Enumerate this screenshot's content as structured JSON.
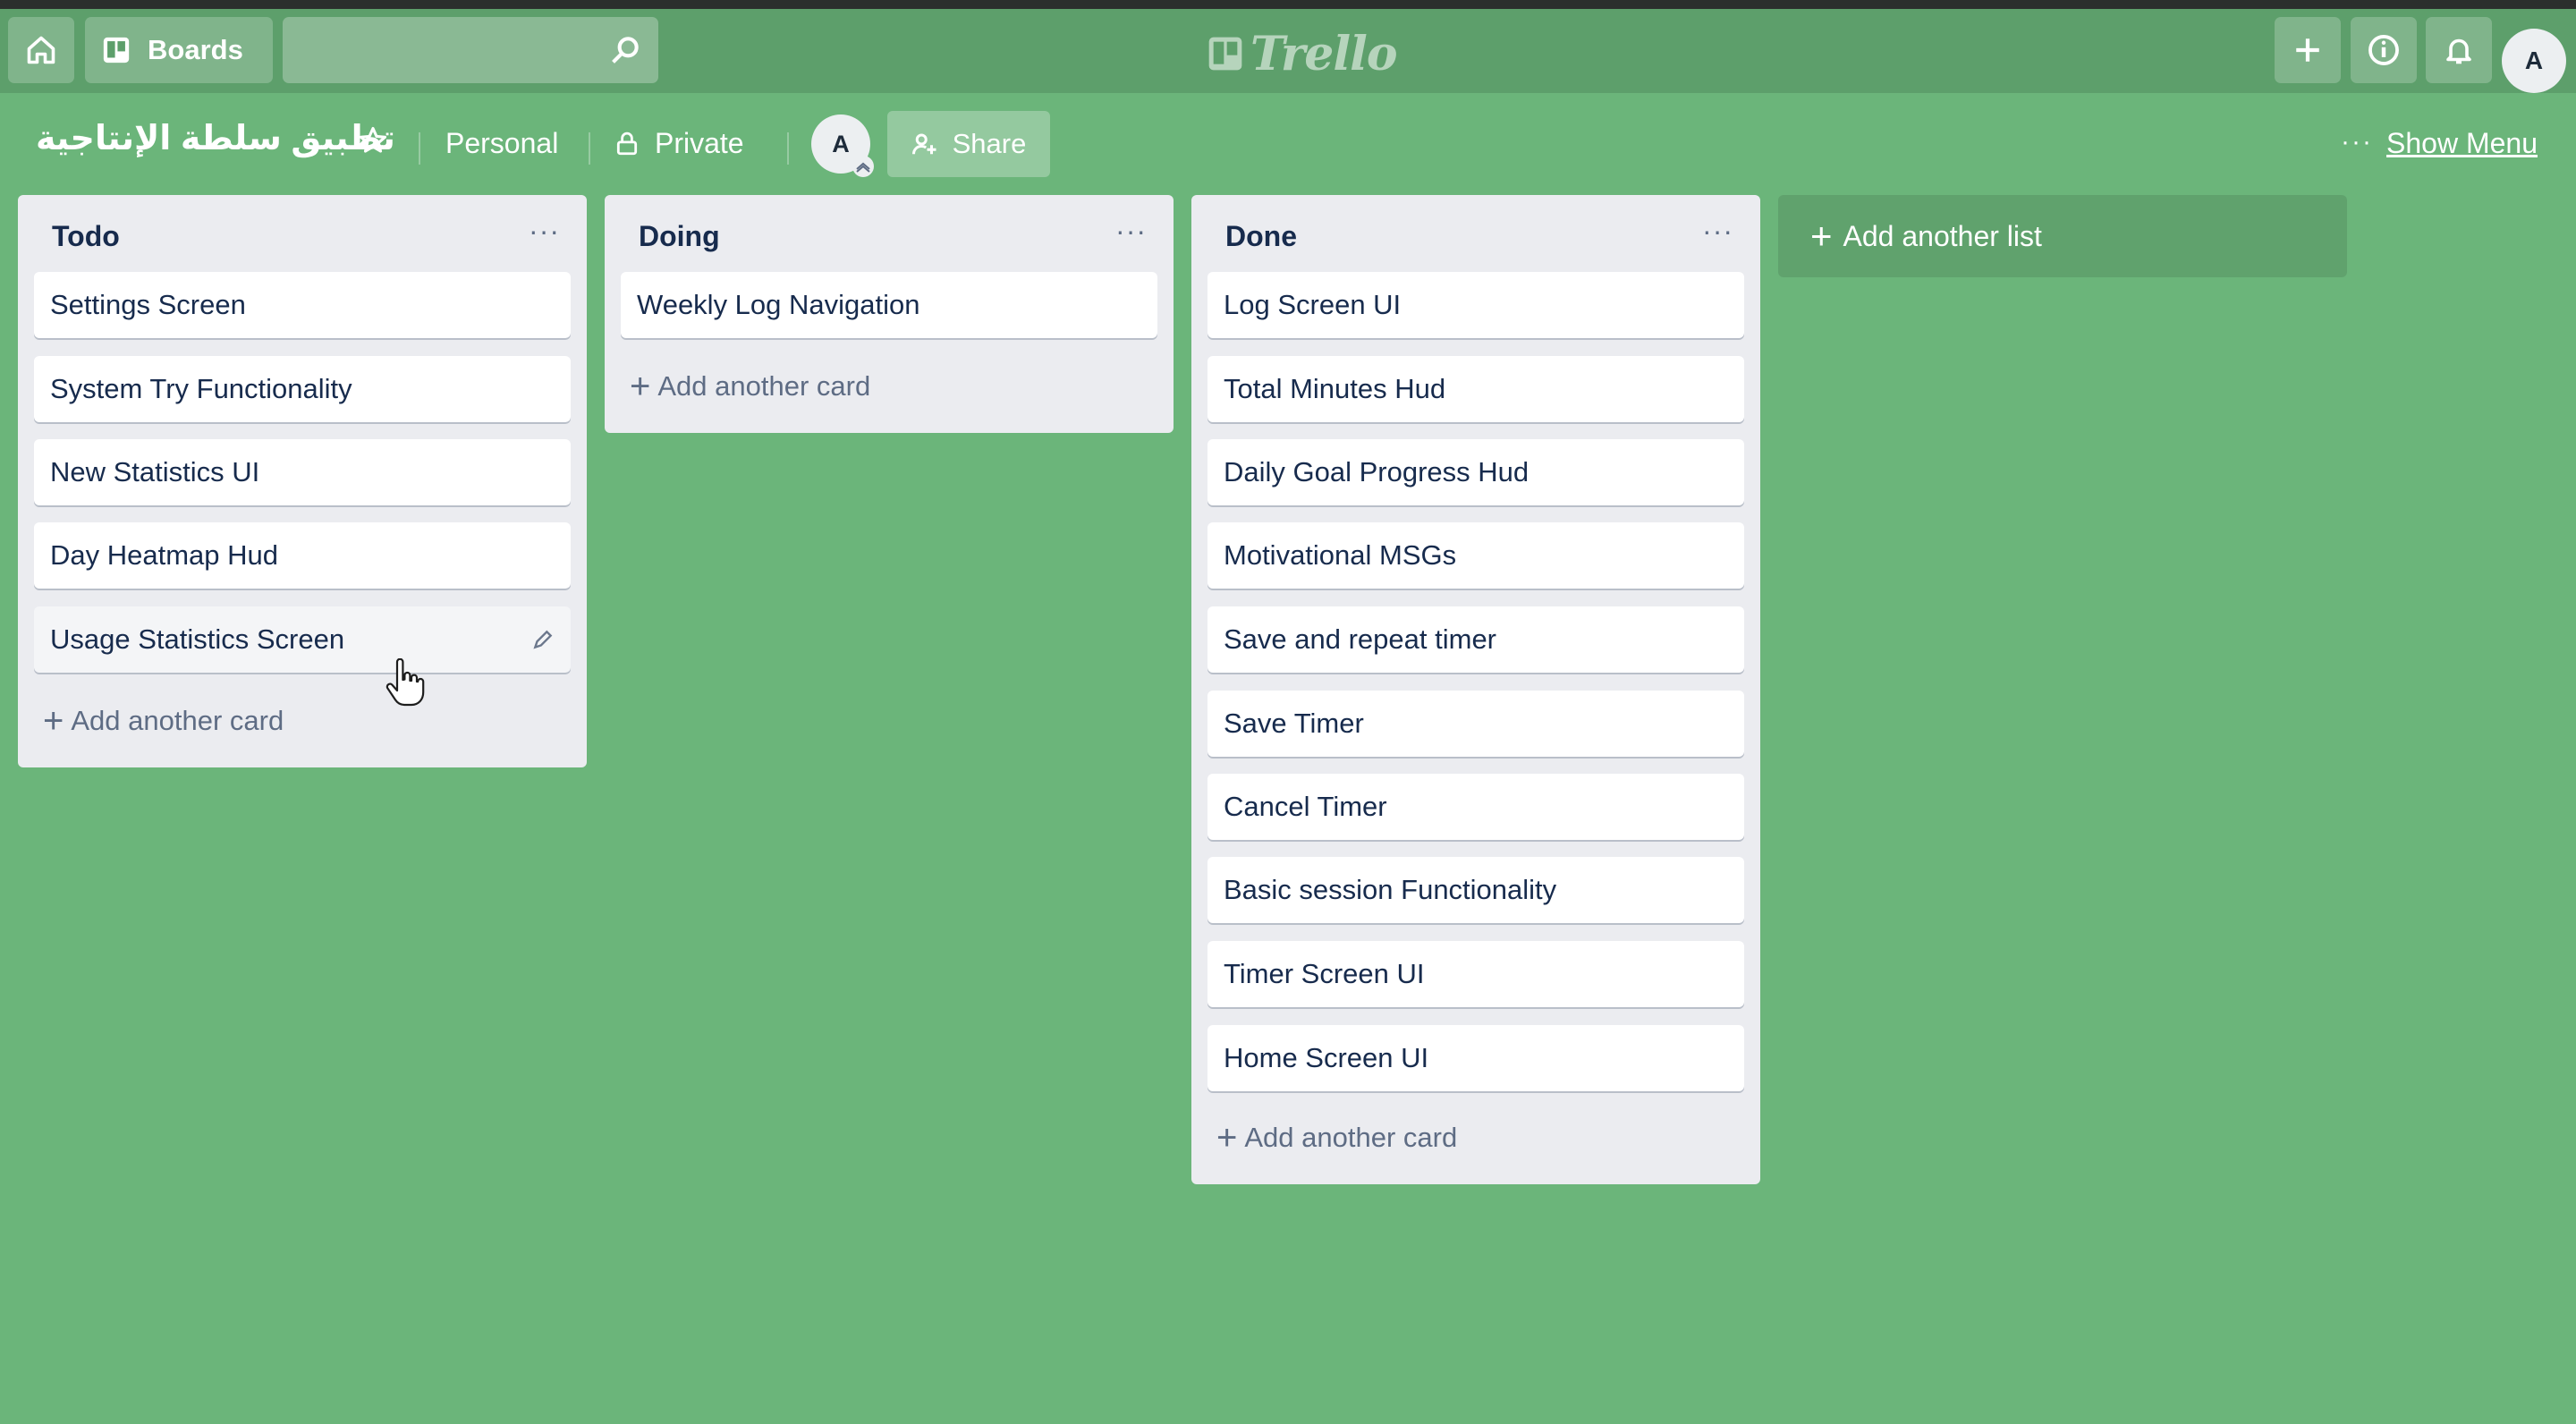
{
  "app": {
    "name": "Trello"
  },
  "topbar": {
    "boards_label": "Boards",
    "search_value": ""
  },
  "board": {
    "title": "تطبيق سلطة الإنتاجية",
    "visibility_team": "Personal",
    "visibility": "Private",
    "member_initial": "A",
    "share_label": "Share",
    "show_menu_label": "Show Menu",
    "dots": "···"
  },
  "user": {
    "initial": "A"
  },
  "lists": [
    {
      "title": "Todo",
      "menu": "···",
      "cards": [
        "Settings Screen",
        "System Try Functionality",
        "New Statistics UI",
        "Day Heatmap Hud",
        "Usage Statistics Screen"
      ],
      "add_card_label": "Add another card"
    },
    {
      "title": "Doing",
      "menu": "···",
      "cards": [
        "Weekly Log Navigation"
      ],
      "add_card_label": "Add another card"
    },
    {
      "title": "Done",
      "menu": "···",
      "cards": [
        "Log Screen UI",
        "Total Minutes Hud",
        "Daily Goal Progress Hud",
        "Motivational MSGs",
        "Save and repeat timer",
        "Save Timer",
        "Cancel Timer",
        "Basic session Functionality",
        "Timer Screen UI",
        "Home Screen UI"
      ],
      "add_card_label": "Add another card"
    }
  ],
  "add_list_label": "Add another list",
  "icons": [
    "home-icon",
    "boards-icon",
    "search-icon",
    "trello-logo-icon",
    "plus-icon",
    "info-icon",
    "bell-icon",
    "star-icon",
    "lock-icon",
    "share-icon",
    "edit-icon",
    "cursor-hand-icon"
  ],
  "colors": {
    "board_bg": "#6bb57a",
    "topbar": "#5d9f6b",
    "list_bg": "#ebecf0"
  }
}
